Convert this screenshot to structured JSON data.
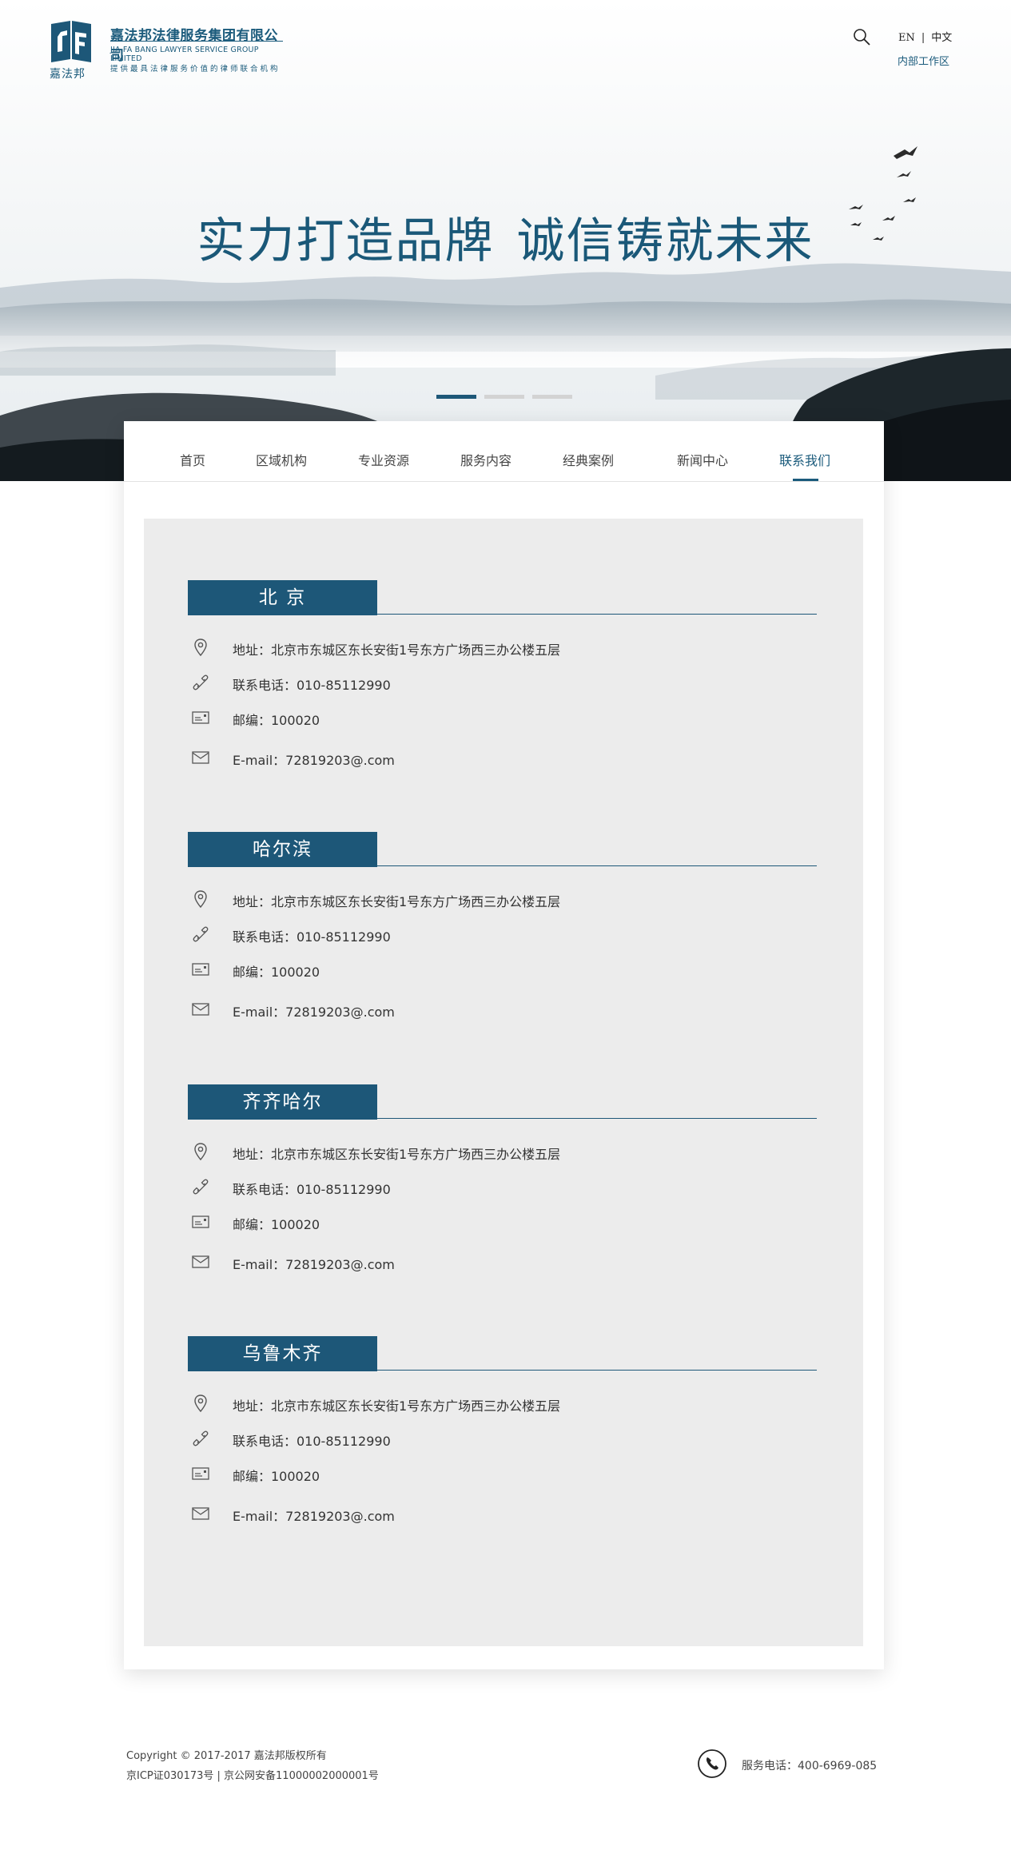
{
  "header": {
    "logo_small_text": "嘉法邦",
    "logo_title": "嘉法邦法律服务集团有限公司",
    "logo_en": "JIA FA BANG LAWYER SERVICE GROUP LIMITED",
    "logo_slogan": "提供最具法律服务价值的律师联合机构",
    "lang_en": "EN",
    "lang_sep": "|",
    "lang_cn": "中文",
    "staff_area": "内部工作区"
  },
  "banner": {
    "title_part1": "实力打造品牌",
    "title_part2": "诚信铸就未来",
    "active_slide": 1,
    "slide_count": 3
  },
  "nav": {
    "items": [
      {
        "label": "首页"
      },
      {
        "label": "区域机构"
      },
      {
        "label": "专业资源"
      },
      {
        "label": "服务内容"
      },
      {
        "label": "经典案例"
      },
      {
        "label": "新闻中心"
      },
      {
        "label": "联系我们"
      }
    ],
    "active_index": 6
  },
  "offices": [
    {
      "name": "北 京",
      "address": "地址：北京市东城区东长安街1号东方广场西三办公楼五层",
      "phone": "联系电话：010-85112990",
      "postcode": "邮编：100020",
      "email": "E-mail：72819203@.com"
    },
    {
      "name": "哈尔滨",
      "address": "地址：北京市东城区东长安街1号东方广场西三办公楼五层",
      "phone": "联系电话：010-85112990",
      "postcode": "邮编：100020",
      "email": "E-mail：72819203@.com"
    },
    {
      "name": "齐齐哈尔",
      "address": "地址：北京市东城区东长安街1号东方广场西三办公楼五层",
      "phone": "联系电话：010-85112990",
      "postcode": "邮编：100020",
      "email": "E-mail：72819203@.com"
    },
    {
      "name": "乌鲁木齐",
      "address": "地址：北京市东城区东长安街1号东方广场西三办公楼五层",
      "phone": "联系电话：010-85112990",
      "postcode": "邮编：100020",
      "email": "E-mail：72819203@.com"
    }
  ],
  "footer": {
    "copyright": "Copyright © 2017-2017 嘉法邦版权所有",
    "icp": "京ICP证030173号 | 京公网安备11000002000001号",
    "service_phone": "服务电话：400-6969-085"
  },
  "colors": {
    "brand": "#1d5778",
    "panel_bg": "#ececec",
    "text": "#333333"
  },
  "icons": {
    "search": "search-icon",
    "location": "location-pin-icon",
    "phone": "phone-icon",
    "postcode": "postcard-icon",
    "email": "envelope-icon"
  }
}
